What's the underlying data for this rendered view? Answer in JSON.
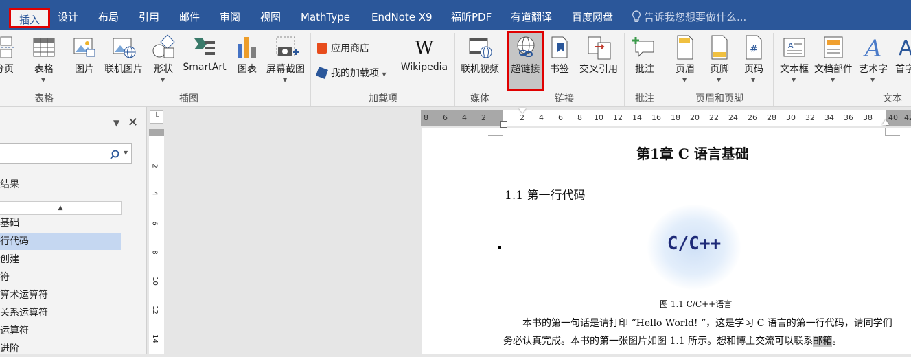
{
  "tabs": {
    "insert": "插入",
    "design": "设计",
    "layout": "布局",
    "references": "引用",
    "mailings": "邮件",
    "review": "审阅",
    "view": "视图",
    "mathtype": "MathType",
    "endnote": "EndNote X9",
    "foxit": "福昕PDF",
    "youdao": "有道翻译",
    "baidu": "百度网盘",
    "tellme": "告诉我您想要做什么..."
  },
  "ribbon": {
    "page_btn": "分页",
    "table_btn": "表格",
    "picture_btn": "图片",
    "online_picture_btn": "联机图片",
    "shapes_btn": "形状",
    "smartart_btn": "SmartArt",
    "chart_btn": "图表",
    "screenshot_btn": "屏幕截图",
    "store_btn": "应用商店",
    "my_addins_btn": "我的加载项",
    "wikipedia_btn": "Wikipedia",
    "online_video_btn": "联机视频",
    "hyperlink_btn": "超链接",
    "bookmark_btn": "书签",
    "crossref_btn": "交叉引用",
    "comment_btn": "批注",
    "header_btn": "页眉",
    "footer_btn": "页脚",
    "pagenum_btn": "页码",
    "textbox_btn": "文本框",
    "quickparts_btn": "文档部件",
    "wordart_btn": "艺术字",
    "dropcap_btn": "首字",
    "groups": {
      "tables": "表格",
      "illustrations": "插图",
      "addins": "加载项",
      "media": "媒体",
      "links": "链接",
      "comments": "批注",
      "header_footer": "页眉和页脚",
      "text": "文本"
    }
  },
  "nav": {
    "results_label": "结果",
    "items": [
      "基础",
      "行代码",
      "创建",
      "符",
      "算术运算符",
      "关系运算符",
      "运算符",
      "进阶"
    ]
  },
  "ruler": {
    "numbers": [
      "8",
      "6",
      "4",
      "2",
      "2",
      "4",
      "6",
      "8",
      "10",
      "12",
      "14",
      "16",
      "18",
      "20",
      "22",
      "24",
      "26",
      "28",
      "30",
      "32",
      "34",
      "36",
      "38",
      "40",
      "42"
    ],
    "vnumbers": [
      "2",
      "4",
      "6",
      "8",
      "10",
      "12",
      "14"
    ]
  },
  "document": {
    "chapter_title": "第1章  C 语言基础",
    "section_title": "1.1 第一行代码",
    "logo_text": "C/C++",
    "figure_caption": "图 1.1 C/C++语言",
    "para_line1": "本书的第一句话是请打印 “Hello World! “，这是学习 C 语言的第一行代码，请同学们",
    "para_line2": "务必认真完成。本书的第一张图片如图 1.1 所示。想和博主交流可以联系",
    "para_highlight": "邮箱",
    "para_end": "。"
  }
}
